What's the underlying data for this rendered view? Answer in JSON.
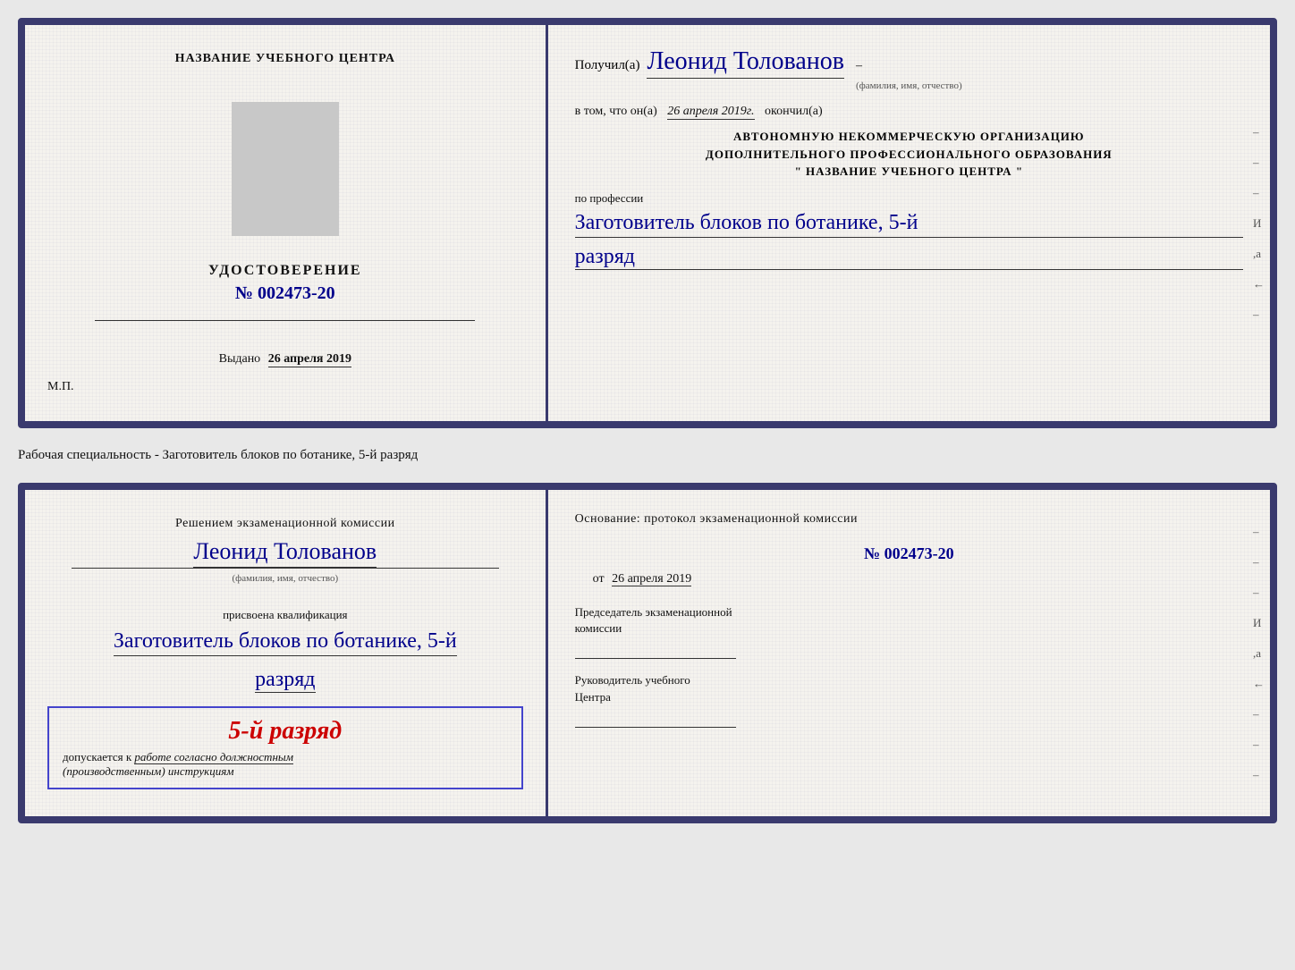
{
  "doc1": {
    "left": {
      "center_title": "НАЗВАНИЕ УЧЕБНОГО ЦЕНТРА",
      "cert_label": "УДОСТОВЕРЕНИЕ",
      "cert_number": "№ 002473-20",
      "issued_label": "Выдано",
      "issued_date": "26 апреля 2019",
      "mp_stamp": "М.П."
    },
    "right": {
      "received_prefix": "Получил(а)",
      "recipient_name": "Леонид Толованов",
      "name_subtitle": "(фамилия, имя, отчество)",
      "in_that_prefix": "в том, что он(а)",
      "date_italic": "26 апреля 2019г.",
      "finished_label": "окончил(а)",
      "org_line1": "АВТОНОМНУЮ НЕКОММЕРЧЕСКУЮ ОРГАНИЗАЦИЮ",
      "org_line2": "ДОПОЛНИТЕЛЬНОГО ПРОФЕССИОНАЛЬНОГО ОБРАЗОВАНИЯ",
      "org_line3": "\"  НАЗВАНИЕ УЧЕБНОГО ЦЕНТРА  \"",
      "profession_label": "по профессии",
      "profession_handwritten": "Заготовитель блоков по ботанике, 5-й",
      "rank_handwritten": "разряд",
      "dash1": "–",
      "dash2": "–",
      "dash3": "–",
      "letter_i": "И",
      "letter_a": ",а",
      "arrow": "←"
    }
  },
  "separator": {
    "text": "Рабочая специальность - Заготовитель блоков по ботанике, 5-й разряд"
  },
  "doc2": {
    "left": {
      "decision_line": "Решением экзаменационной комиссии",
      "recipient_name": "Леонид Толованов",
      "name_subtitle": "(фамилия, имя, отчество)",
      "qualified_label": "присвоена квалификация",
      "profession_handwritten": "Заготовитель блоков по ботанике, 5-й",
      "rank_handwritten": "разряд",
      "stamp_rank": "5-й разряд",
      "stamp_allowed": "допускается к",
      "stamp_work": "работе согласно должностным",
      "stamp_instructions": "(производственным) инструкциям"
    },
    "right": {
      "basis_text": "Основание: протокол экзаменационной комиссии",
      "protocol_number": "№  002473-20",
      "from_prefix": "от",
      "from_date": "26 апреля 2019",
      "chair_label1": "Председатель экзаменационной",
      "chair_label2": "комиссии",
      "head_label1": "Руководитель учебного",
      "head_label2": "Центра",
      "dash1": "–",
      "dash2": "–",
      "dash3": "–",
      "letter_i": "И",
      "letter_a": ",а",
      "arrow": "←"
    }
  }
}
